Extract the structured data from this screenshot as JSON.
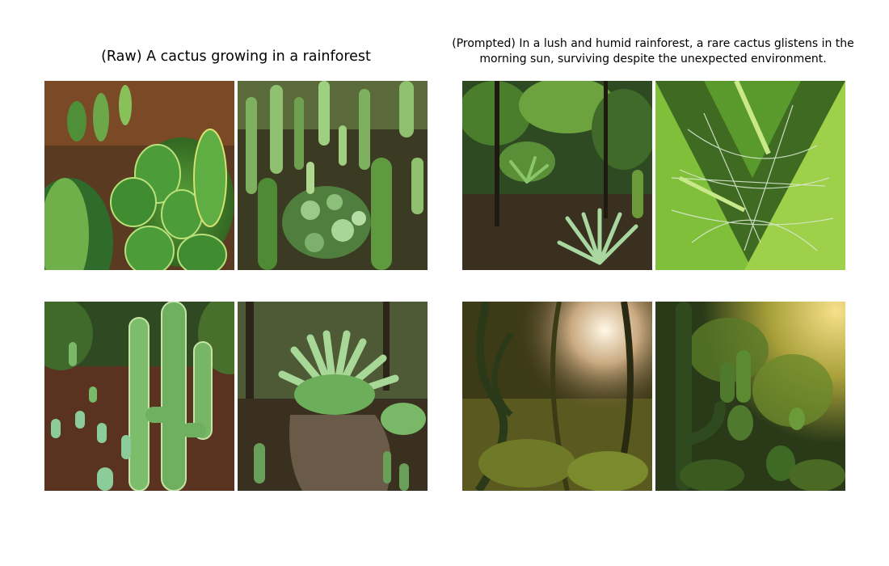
{
  "left_panel": {
    "title": "(Raw) A cactus growing in a rainforest",
    "images": [
      {
        "subject": "close-up cluster of spiny green cacti"
      },
      {
        "subject": "dense field of many green cacti"
      },
      {
        "subject": "tall columnar cactus on brown soil with seedlings"
      },
      {
        "subject": "spiky agave-like plant growing from a stump"
      }
    ]
  },
  "right_panel": {
    "title": "(Prompted) In a lush and humid rainforest, a rare cactus glistens in the morning sun, surviving despite the unexpected environment.",
    "images": [
      {
        "subject": "rainforest floor with spiky plant"
      },
      {
        "subject": "green fronds with web-like strands"
      },
      {
        "subject": "jungle with vines and sunlight"
      },
      {
        "subject": "golden-lit jungle with cacti"
      }
    ]
  }
}
